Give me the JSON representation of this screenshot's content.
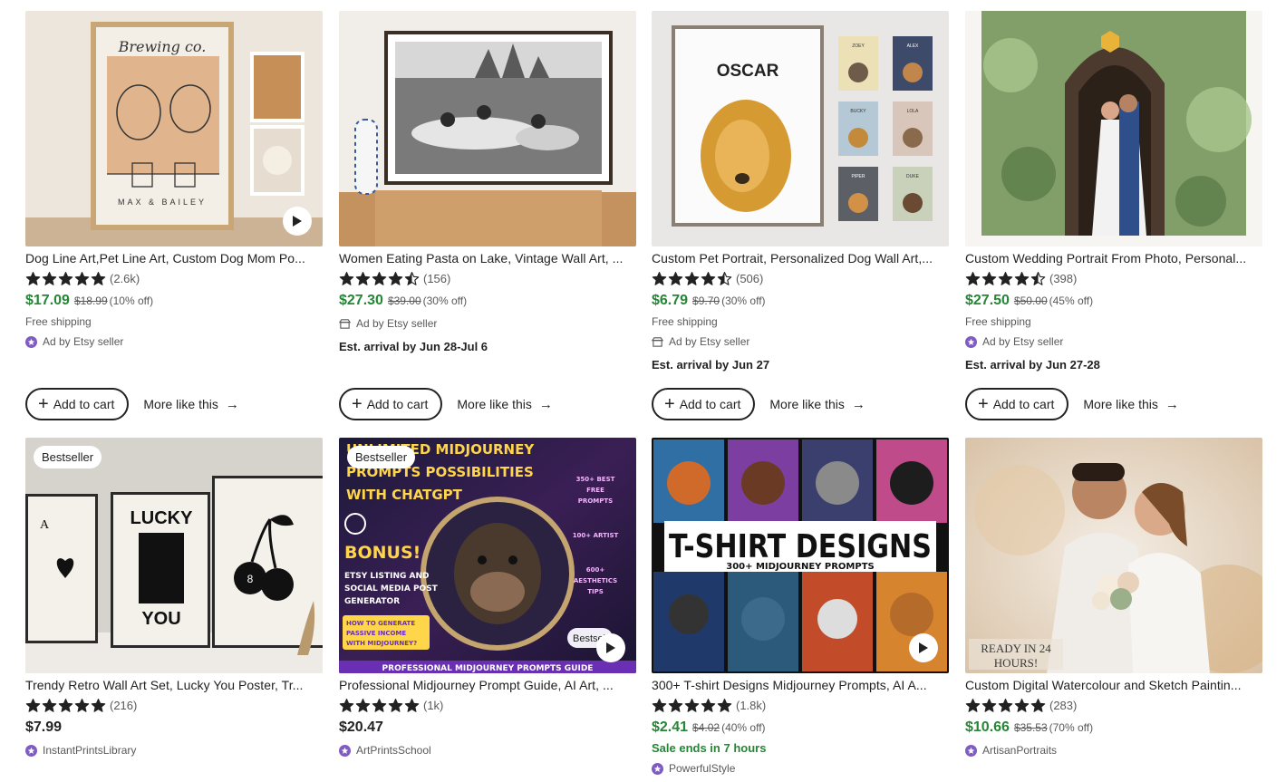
{
  "colors": {
    "sale_green": "#258635",
    "text": "#222222",
    "muted": "#595959",
    "star": "#222222",
    "seller_badge": "#7f5cc1"
  },
  "add_to_cart_label": "Add to cart",
  "more_like_this_label": "More like this",
  "bestseller_label": "Bestseller",
  "products": [
    {
      "title": "Dog Line Art,Pet Line Art, Custom Dog Mom Po...",
      "rating": 5,
      "reviews": "(2.6k)",
      "price": "$17.09",
      "original_price": "$18.99",
      "discount": "(10% off)",
      "shipping": "Free shipping",
      "ad": "Ad by Etsy seller",
      "image_text": {
        "top": "Brewing co.",
        "bottom": "MAX & BAILEY"
      }
    },
    {
      "title": "Women Eating Pasta on Lake, Vintage Wall Art, ...",
      "rating": 4.5,
      "reviews": "(156)",
      "price": "$27.30",
      "original_price": "$39.00",
      "discount": "(30% off)",
      "ad": "Ad by Etsy seller",
      "arrival": "Est. arrival by Jun 28-Jul 6"
    },
    {
      "title": "Custom Pet Portrait, Personalized Dog Wall Art,...",
      "rating": 4.5,
      "reviews": "(506)",
      "price": "$6.79",
      "original_price": "$9.70",
      "discount": "(30% off)",
      "shipping": "Free shipping",
      "ad": "Ad by Etsy seller",
      "arrival": "Est. arrival by Jun 27",
      "image_text": {
        "name": "OSCAR",
        "tiles": [
          "ZOEY",
          "ALEX",
          "BUCKY",
          "LOLA",
          "PIPER",
          "DUKE"
        ]
      }
    },
    {
      "title": "Custom Wedding Portrait From Photo, Personal...",
      "rating": 4.5,
      "reviews": "(398)",
      "price": "$27.50",
      "original_price": "$50.00",
      "discount": "(45% off)",
      "shipping": "Free shipping",
      "ad": "Ad by Etsy seller",
      "arrival": "Est. arrival by Jun 27-28"
    },
    {
      "title": "Trendy Retro Wall Art Set, Lucky You Poster, Tr...",
      "rating": 5,
      "reviews": "(216)",
      "price": "$7.99",
      "shop": "InstantPrintsLibrary",
      "bestseller": true,
      "image_text": {
        "lucky": "LUCKY",
        "you": "YOU",
        "ace": "A",
        "eight": "8"
      }
    },
    {
      "title": "Professional Midjourney Prompt Guide, AI Art, ...",
      "rating": 5,
      "reviews": "(1k)",
      "price": "$20.47",
      "shop": "ArtPrintsSchool",
      "bestseller": true,
      "image_text": {
        "l1": "UNLIMITED MIDJOURNEY",
        "l2": "PROMPTS POSSIBILITIES",
        "l3": "WITH CHATGPT",
        "bonus": "BONUS!",
        "b1": "ETSY LISTING AND",
        "b2": "SOCIAL MEDIA POST",
        "b3": "GENERATOR",
        "p1": "HOW TO GENERATE",
        "p2": "PASSIVE INCOME",
        "p3": "WITH MIDJOURNEY?",
        "r1": "350+ BEST",
        "r2": "FREE",
        "r3": "PROMPTS",
        "r4": "100+ ARTIST",
        "r5": "600+",
        "r6": "AESTHETICS",
        "r7": "TIPS",
        "footer": "PROFESSIONAL MIDJOURNEY PROMPTS GUIDE",
        "corner": "Bestsel"
      }
    },
    {
      "title": "300+ T-shirt Designs Midjourney Prompts, AI A...",
      "rating": 5,
      "reviews": "(1.8k)",
      "price": "$2.41",
      "original_price": "$4.02",
      "discount": "(40% off)",
      "sale_ends": "Sale ends in 7 hours",
      "shop": "PowerfulStyle",
      "image_text": {
        "headline": "T-SHIRT DESIGNS",
        "sub": "300+ MIDJOURNEY PROMPTS"
      }
    },
    {
      "title": "Custom Digital Watercolour and Sketch Paintin...",
      "rating": 5,
      "reviews": "(283)",
      "price": "$10.66",
      "original_price": "$35.53",
      "discount": "(70% off)",
      "shop": "ArtisanPortraits",
      "image_text": {
        "ready1": "READY IN 24",
        "ready2": "HOURS!"
      }
    }
  ]
}
